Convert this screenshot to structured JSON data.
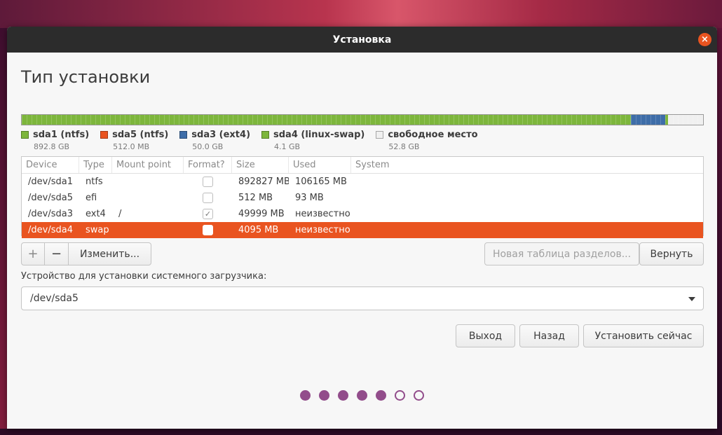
{
  "window": {
    "title": "Установка",
    "close_glyph": "×"
  },
  "page": {
    "title": "Тип установки"
  },
  "colors": {
    "ntfs": "#7db63c",
    "efi": "#e95420",
    "ext4": "#3e6da8",
    "swap": "#7db63c",
    "free": "#f0f0f0",
    "accent": "#e95420"
  },
  "partition_bar": [
    {
      "name": "sda1",
      "fraction": 0.8936,
      "color": "#7db63c"
    },
    {
      "name": "sda5",
      "fraction": 0.0005,
      "color": "#e95420"
    },
    {
      "name": "sda3",
      "fraction": 0.05,
      "color": "#3e6da8"
    },
    {
      "name": "sda4",
      "fraction": 0.0041,
      "color": "#7db63c"
    },
    {
      "name": "free",
      "fraction": 0.0518,
      "color": "#f0f0f0"
    }
  ],
  "legend": [
    {
      "label": "sda1 (ntfs)",
      "size": "892.8 GB",
      "color": "#7db63c"
    },
    {
      "label": "sda5 (ntfs)",
      "size": "512.0 MB",
      "color": "#e95420"
    },
    {
      "label": "sda3 (ext4)",
      "size": "50.0 GB",
      "color": "#3e6da8"
    },
    {
      "label": "sda4 (linux-swap)",
      "size": "4.1 GB",
      "color": "#7db63c"
    },
    {
      "label": "свободное место",
      "size": "52.8 GB",
      "color": "#f0f0f0"
    }
  ],
  "table": {
    "headers": [
      "Device",
      "Type",
      "Mount point",
      "Format?",
      "Size",
      "Used",
      "System"
    ],
    "rows": [
      {
        "device": "/dev/sda1",
        "type": "ntfs",
        "mount": "",
        "format": false,
        "size": "892827 MB",
        "used": "106165 MB",
        "system": "",
        "selected": false
      },
      {
        "device": "/dev/sda5",
        "type": "efi",
        "mount": "",
        "format": false,
        "size": "512 MB",
        "used": "93 MB",
        "system": "",
        "selected": false
      },
      {
        "device": "/dev/sda3",
        "type": "ext4",
        "mount": "/",
        "format": true,
        "size": "49999 MB",
        "used": "неизвестно",
        "system": "",
        "selected": false
      },
      {
        "device": "/dev/sda4",
        "type": "swap",
        "mount": "",
        "format": false,
        "size": "4095 MB",
        "used": "неизвестно",
        "system": "",
        "selected": true
      }
    ]
  },
  "toolbar": {
    "add_label": "+",
    "remove_label": "−",
    "change_label": "Изменить...",
    "new_table_label": "Новая таблица разделов...",
    "revert_label": "Вернуть"
  },
  "bootloader": {
    "label": "Устройство для установки системного загрузчика:",
    "value": "/dev/sda5"
  },
  "actions": {
    "quit_label": "Выход",
    "back_label": "Назад",
    "install_label": "Установить сейчас"
  },
  "progress": {
    "total_steps": 7,
    "completed_steps": 5
  }
}
